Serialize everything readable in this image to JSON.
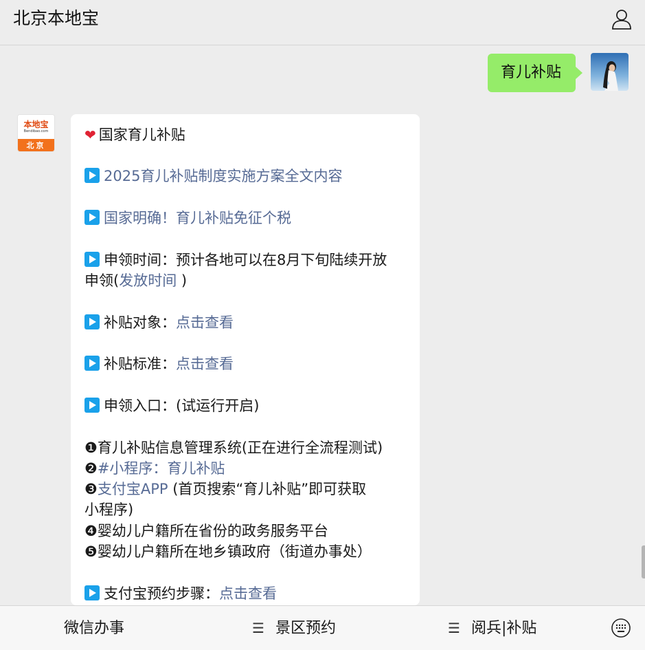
{
  "header": {
    "title": "北京本地宝",
    "user_icon": "user-icon"
  },
  "outgoing": {
    "text": "育儿补贴"
  },
  "bot_avatar": {
    "brand": "本地宝",
    "sub": "Bendibao.com",
    "city": "北京"
  },
  "reply": {
    "title": "国家育儿补贴",
    "item1_link": "2025育儿补贴制度实施方案全文内容",
    "item2_link": "国家明确！育儿补贴免征个税",
    "item3_text": "申领时间：预计各地可以在8月下旬陆续开放",
    "item3_prefix": "申领(",
    "item3_link": "发放时间",
    "item3_suffix": " )",
    "item4_label": "补贴对象：",
    "item4_link": "点击查看",
    "item5_label": "补贴标准：",
    "item5_link": "点击查看",
    "item6_text": "申领入口：(试运行开启)",
    "list1": "育儿补贴信息管理系统(正在进行全流程测试)",
    "list2_link": "#小程序：育儿补贴",
    "list3_link": "支付宝APP",
    "list3_text": " (首页搜索“育儿补贴”即可获取",
    "list3_cont": "小程序)",
    "list4": "婴幼儿户籍所在省份的政务服务平台",
    "list5": "婴幼儿户籍所在地乡镇政府（街道办事处）",
    "item7_label": "支付宝预约步骤：",
    "item7_link": "点击查看",
    "markers": [
      "❶",
      "❷",
      "❸",
      "❹",
      "❺"
    ],
    "heart": "❤"
  },
  "bottom_menu": {
    "items": [
      {
        "label": "微信办事",
        "has_menu_icon": false
      },
      {
        "label": "景区预约",
        "has_menu_icon": true
      },
      {
        "label": "阅兵|补贴",
        "has_menu_icon": true
      }
    ],
    "menu_glyph": "☰",
    "keyboard_icon": "keyboard-icon"
  },
  "colors": {
    "link": "#576b95",
    "bubble_out": "#95ec69",
    "play_icon": "#1aa1ea",
    "background": "#ededed"
  }
}
